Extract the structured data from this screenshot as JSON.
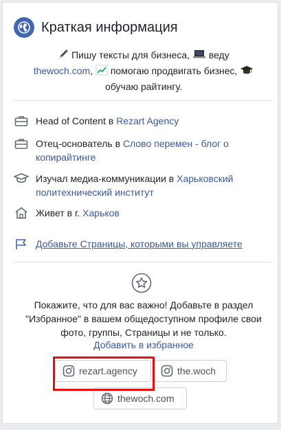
{
  "header": {
    "title": "Краткая информация",
    "icon": "globe-icon"
  },
  "bio": {
    "line1_text": " Пишу тексты для бизнеса, ",
    "line1_text2": " веду",
    "site_link": "thewoch.com",
    "line2_text": " помогаю продвигать бизнес, ",
    "line3_text": "обучаю райтингу."
  },
  "info": [
    {
      "icon": "briefcase-icon",
      "prefix": "Head of Content в ",
      "link": "Rezart Agency"
    },
    {
      "icon": "briefcase-icon",
      "prefix": "Отец-основатель в ",
      "link": "Слово перемен - блог о копирайтинге"
    },
    {
      "icon": "graduation-cap-icon",
      "prefix": "Изучал медиа-коммуникации в ",
      "link": "Харьковский политехнический институт"
    },
    {
      "icon": "house-icon",
      "prefix": "Живет в г. ",
      "link": "Харьков"
    }
  ],
  "add_pages": {
    "icon": "flag-icon",
    "label": "Добавьте Страницы, которыми вы управляете"
  },
  "featured": {
    "icon": "star-icon",
    "text": "Покажите, что для вас важно! Добавьте в раздел \"Избранное\" в вашем общедоступном профиле свои фото, группы, Страницы и не только.",
    "link": "Добавить в избранное"
  },
  "chips": [
    {
      "icon": "instagram-icon",
      "label": "rezart.agency"
    },
    {
      "icon": "instagram-icon",
      "label": "the.woch"
    },
    {
      "icon": "globe-icon",
      "label": "thewoch.com"
    }
  ],
  "colors": {
    "link": "#385898",
    "accent": "#4267b2",
    "highlight": "#e60f0f"
  }
}
